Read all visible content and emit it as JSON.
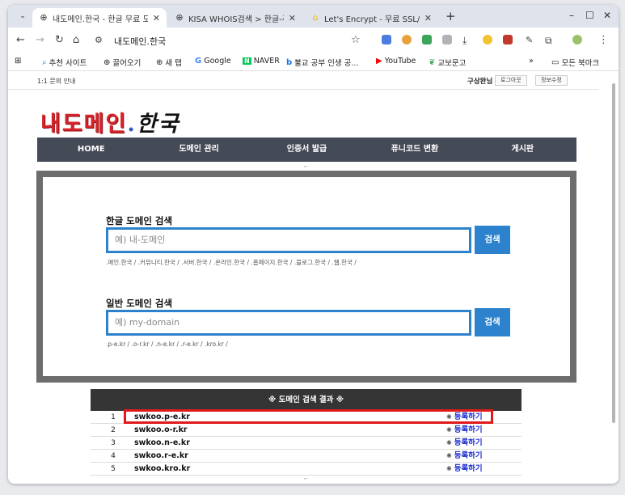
{
  "browser": {
    "tabs": [
      {
        "title": "내도메인.한국 - 한글 무료 도",
        "active": true
      },
      {
        "title": "KISA WHOIS검색 > 한글-퓨",
        "active": false
      },
      {
        "title": "Let's Encrypt - 무료 SSL/TLS",
        "active": false
      }
    ],
    "address": "내도메인.한국",
    "bookmarks": [
      "추천 사이트",
      "끌어오기",
      "새 탭",
      "Google",
      "NAVER",
      "불교 공부 인생 공...",
      "YouTube",
      "교보문고"
    ],
    "all_bookmarks": "모든 북마크"
  },
  "page": {
    "inquiry": "1:1 문의 안내",
    "username": "구상완님",
    "logout": "로그아웃",
    "edit_info": "정보수정",
    "logo": {
      "part1": "내도메인",
      "dot": ".",
      "part2": "한국"
    },
    "nav": [
      "HOME",
      "도메인 관리",
      "인증서 발급",
      "퓨니코드 변환",
      "게시판"
    ],
    "korean_search": {
      "title": "한글 도메인 검색",
      "placeholder": "예) 내-도메인",
      "button": "검색",
      "hint": ".메인.한국 / .커뮤니티.한국 / .서버.한국 / .온라인.한국 / .홈페이지.한국 / .블로그.한국 / .웹.한국 /"
    },
    "general_search": {
      "title": "일반 도메인 검색",
      "placeholder": "예) my-domain",
      "button": "검색",
      "hint": ".p-e.kr / .o-r.kr / .n-e.kr / .r-e.kr / .kro.kr /"
    },
    "results": {
      "header": "※ 도메인 검색 결과 ※",
      "rows": [
        {
          "num": "1",
          "domain": "swkoo.p-e.kr",
          "action": "등록하기"
        },
        {
          "num": "2",
          "domain": "swkoo.o-r.kr",
          "action": "등록하기"
        },
        {
          "num": "3",
          "domain": "swkoo.n-e.kr",
          "action": "등록하기"
        },
        {
          "num": "4",
          "domain": "swkoo.r-e.kr",
          "action": "등록하기"
        },
        {
          "num": "5",
          "domain": "swkoo.kro.kr",
          "action": "등록하기"
        }
      ]
    }
  },
  "colors": {
    "accent": "#2c82cc",
    "nav_bg": "#454a57",
    "logo_red": "#d8232a",
    "highlight": "#e01a1a",
    "link": "#1d2fd0"
  }
}
